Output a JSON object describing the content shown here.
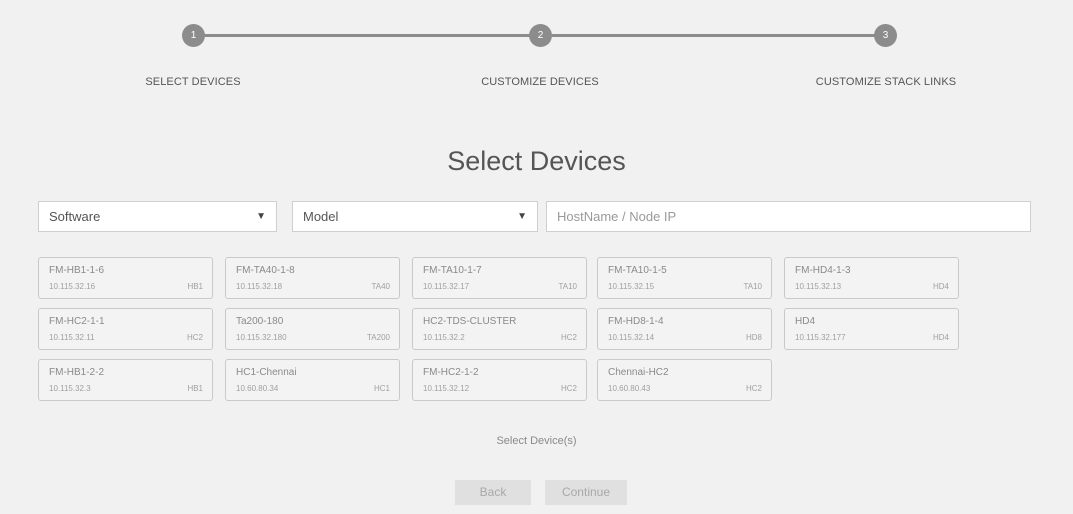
{
  "stepper": {
    "steps": [
      {
        "number": "1",
        "label": "SELECT DEVICES"
      },
      {
        "number": "2",
        "label": "CUSTOMIZE DEVICES"
      },
      {
        "number": "3",
        "label": "CUSTOMIZE STACK LINKS"
      }
    ]
  },
  "page": {
    "title": "Select Devices"
  },
  "filters": {
    "software_value": "Software",
    "model_value": "Model",
    "search_placeholder": "HostName / Node IP"
  },
  "devices": [
    {
      "name": "FM-HB1-1-6",
      "ip": "10.115.32.16",
      "model": "HB1"
    },
    {
      "name": "FM-TA40-1-8",
      "ip": "10.115.32.18",
      "model": "TA40"
    },
    {
      "name": "FM-TA10-1-7",
      "ip": "10.115.32.17",
      "model": "TA10"
    },
    {
      "name": "FM-TA10-1-5",
      "ip": "10.115.32.15",
      "model": "TA10"
    },
    {
      "name": "FM-HD4-1-3",
      "ip": "10.115.32.13",
      "model": "HD4"
    },
    {
      "name": "FM-HC2-1-1",
      "ip": "10.115.32.11",
      "model": "HC2"
    },
    {
      "name": "Ta200-180",
      "ip": "10.115.32.180",
      "model": "TA200"
    },
    {
      "name": "HC2-TDS-CLUSTER",
      "ip": "10.115.32.2",
      "model": "HC2"
    },
    {
      "name": "FM-HD8-1-4",
      "ip": "10.115.32.14",
      "model": "HD8"
    },
    {
      "name": "HD4",
      "ip": "10.115.32.177",
      "model": "HD4"
    },
    {
      "name": "FM-HB1-2-2",
      "ip": "10.115.32.3",
      "model": "HB1"
    },
    {
      "name": "HC1-Chennai",
      "ip": "10.60.80.34",
      "model": "HC1"
    },
    {
      "name": "FM-HC2-1-2",
      "ip": "10.115.32.12",
      "model": "HC2"
    },
    {
      "name": "Chennai-HC2",
      "ip": "10.60.80.43",
      "model": "HC2"
    }
  ],
  "hint": "Select Device(s)",
  "buttons": {
    "back": "Back",
    "continue": "Continue"
  },
  "icons": {
    "dropdown": "triangle-down-icon"
  },
  "colors": {
    "background": "#f1f1f1",
    "step": "#8c8c8c",
    "button_disabled": "#e0e0e0"
  }
}
